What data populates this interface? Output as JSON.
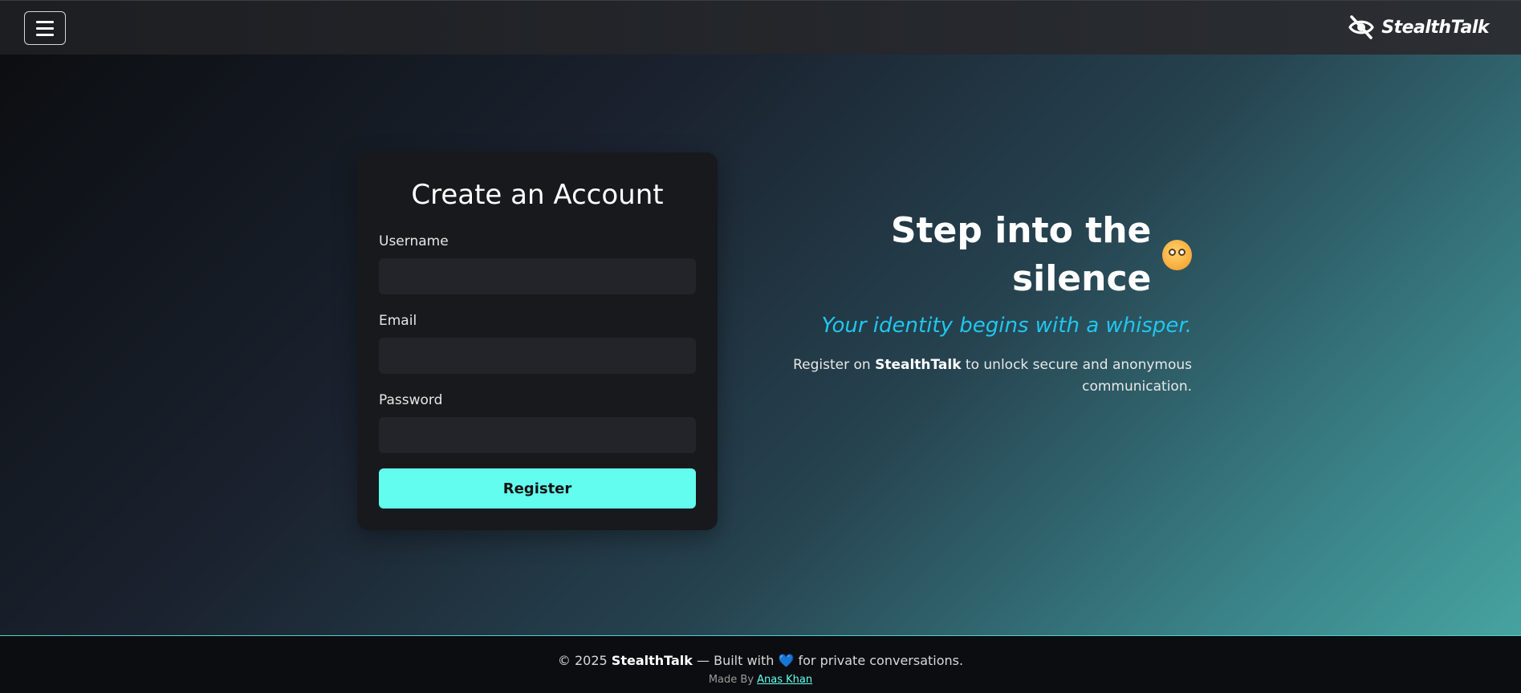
{
  "navbar": {
    "brand": "StealthTalk",
    "menu_icon": "hamburger-menu-icon",
    "logo_icon": "eye-slash-icon"
  },
  "form": {
    "title": "Create an Account",
    "username_label": "Username",
    "username_value": "",
    "email_label": "Email",
    "email_value": "",
    "password_label": "Password",
    "password_value": "",
    "submit_label": "Register"
  },
  "promo": {
    "title": "Step into the silence",
    "emoji": "shushing-face-emoji",
    "subtitle": "Your identity begins with a whisper.",
    "text_before": "Register on ",
    "text_brand": "StealthTalk",
    "text_after": " to unlock secure and anonymous communication."
  },
  "footer": {
    "copyright": "© 2025 ",
    "brand": "StealthTalk",
    "built_with": " — Built with ",
    "heart": "💙",
    "tagline": " for private conversations.",
    "made_by": "Made By ",
    "author": "Anas Khan"
  },
  "colors": {
    "accent": "#62fdee",
    "subtitle": "#21c6ee",
    "card_bg": "#18191c",
    "input_bg": "#222429"
  }
}
